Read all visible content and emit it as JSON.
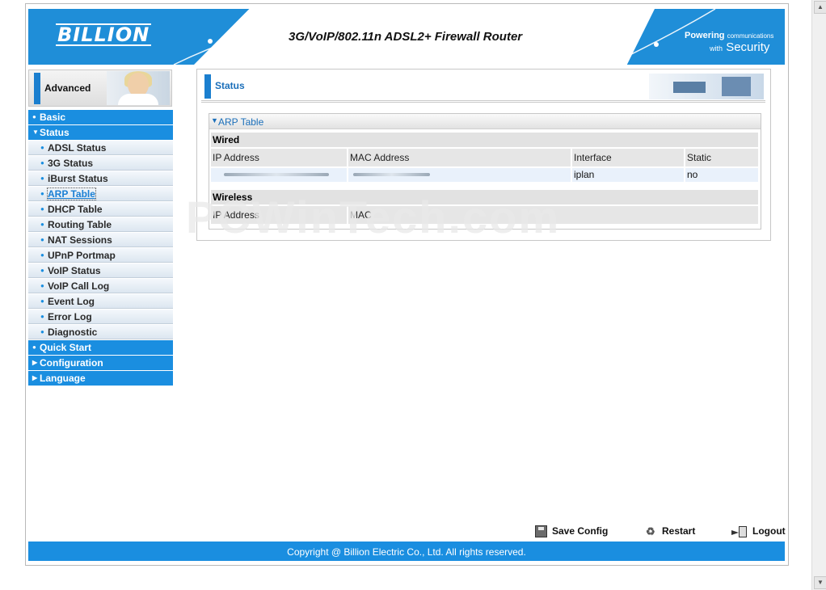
{
  "header": {
    "logo": "BILLION",
    "product_title": "3G/VoIP/802.11n ADSL2+ Firewall Router",
    "tagline_powering": "Powering",
    "tagline_communications": "communications",
    "tagline_with": "with",
    "tagline_security": "Security"
  },
  "mode": {
    "label": "Advanced"
  },
  "sidebar": {
    "sections": [
      {
        "label": "Basic",
        "expanded": false
      },
      {
        "label": "Status",
        "expanded": true
      },
      {
        "label": "Quick Start",
        "expanded": false
      },
      {
        "label": "Configuration",
        "expanded": false
      },
      {
        "label": "Language",
        "expanded": false
      }
    ],
    "status_items": [
      "ADSL Status",
      "3G Status",
      "iBurst Status",
      "ARP Table",
      "DHCP Table",
      "Routing Table",
      "NAT Sessions",
      "UPnP Portmap",
      "VoIP Status",
      "VoIP Call Log",
      "Event Log",
      "Error Log",
      "Diagnostic"
    ],
    "active_item": "ARP Table"
  },
  "content": {
    "title": "Status",
    "arp": {
      "title": "ARP Table",
      "wired": {
        "heading": "Wired",
        "columns": [
          "IP Address",
          "MAC Address",
          "Interface",
          "Static"
        ],
        "rows": [
          {
            "interface": "iplan",
            "static": "no"
          }
        ]
      },
      "wireless": {
        "heading": "Wireless",
        "columns": [
          "IP Address",
          "MAC"
        ]
      }
    }
  },
  "watermark": "PCWinTech.com",
  "actions": {
    "save": "Save Config",
    "restart": "Restart",
    "logout": "Logout"
  },
  "footer": {
    "copyright": "Copyright @ Billion Electric Co., Ltd. All rights reserved."
  },
  "colors": {
    "accent": "#1a8ee0",
    "active_link": "#1a7fd4",
    "row_highlight": "#e9f1fb"
  }
}
